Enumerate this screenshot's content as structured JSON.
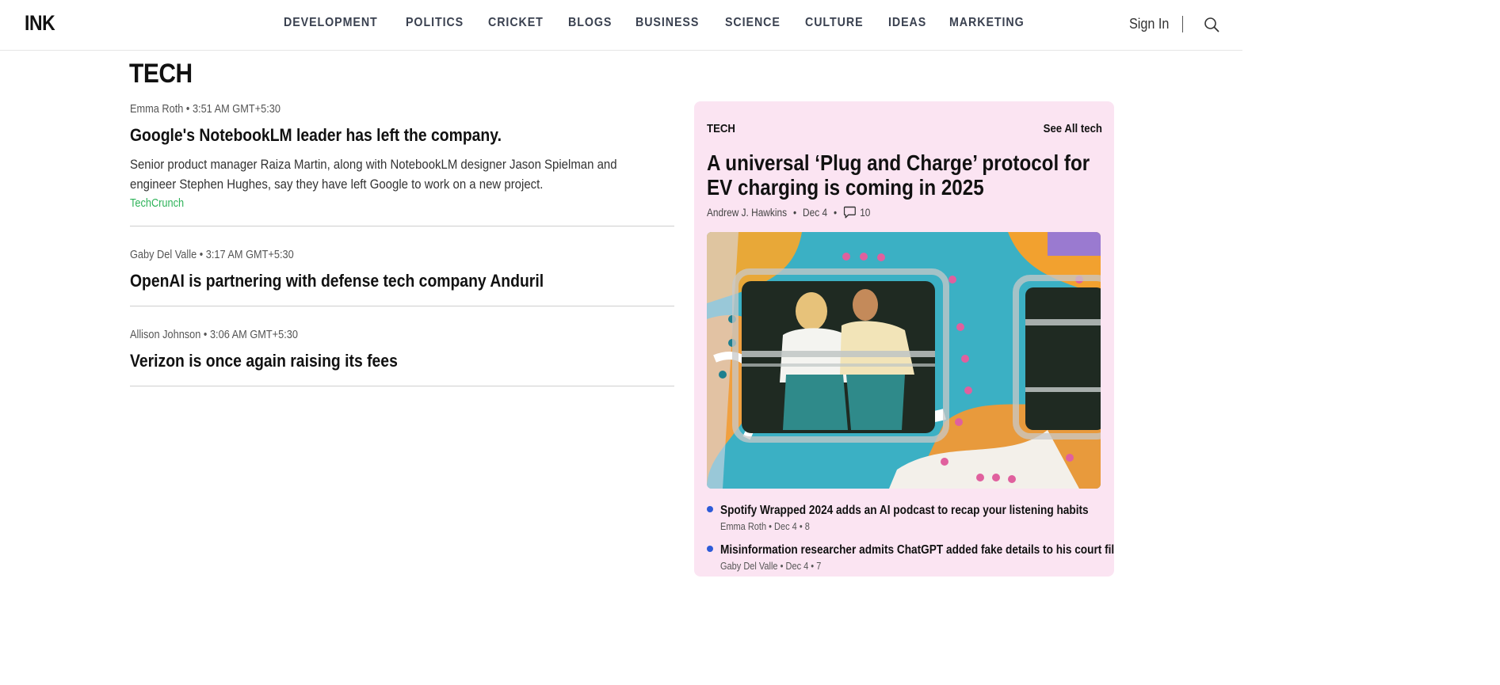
{
  "header": {
    "logo": "INK",
    "nav": [
      "DEVELOPMENT",
      "POLITICS",
      "CRICKET",
      "BLOGS",
      "BUSINESS",
      "SCIENCE",
      "CULTURE",
      "IDEAS",
      "MARKETING"
    ],
    "sign_in": "Sign In"
  },
  "page": {
    "title": "TECH"
  },
  "stories": [
    {
      "author": "Emma Roth",
      "time": "3:51 AM GMT+5:30",
      "headline": "Google's NotebookLM leader has left the company.",
      "description": "Senior product manager Raiza Martin, along with NotebookLM designer Jason Spielman and engineer Stephen Hughes, say they have left Google to work on a new project.",
      "source": "TechCrunch"
    },
    {
      "author": "Gaby Del Valle",
      "time": "3:17 AM GMT+5:30",
      "headline": "OpenAI is partnering with defense tech company Anduril"
    },
    {
      "author": "Allison Johnson",
      "time": "3:06 AM GMT+5:30",
      "headline": "Verizon is once again raising its fees"
    }
  ],
  "sidebar": {
    "tag": "TECH",
    "see_all": "See All tech",
    "headline": "A universal ‘Plug and Charge’ protocol for EV charging is coming in 2025",
    "author": "Andrew J. Hawkins",
    "date": "Dec 4",
    "comments": "10",
    "bullets": [
      {
        "title": "Spotify Wrapped 2024 adds an AI podcast to recap your listening habits",
        "meta": "Emma Roth • Dec 4 • 8"
      },
      {
        "title": "Misinformation researcher admits ChatGPT added fake details to his court filing",
        "meta": "Gaby Del Valle • Dec 4 • 7"
      }
    ]
  },
  "colors": {
    "nav_text": "#3a4150",
    "source_link": "#2fb35a",
    "card_bg": "#fbe4f2",
    "bullet_dot": "#2d5bd8"
  }
}
